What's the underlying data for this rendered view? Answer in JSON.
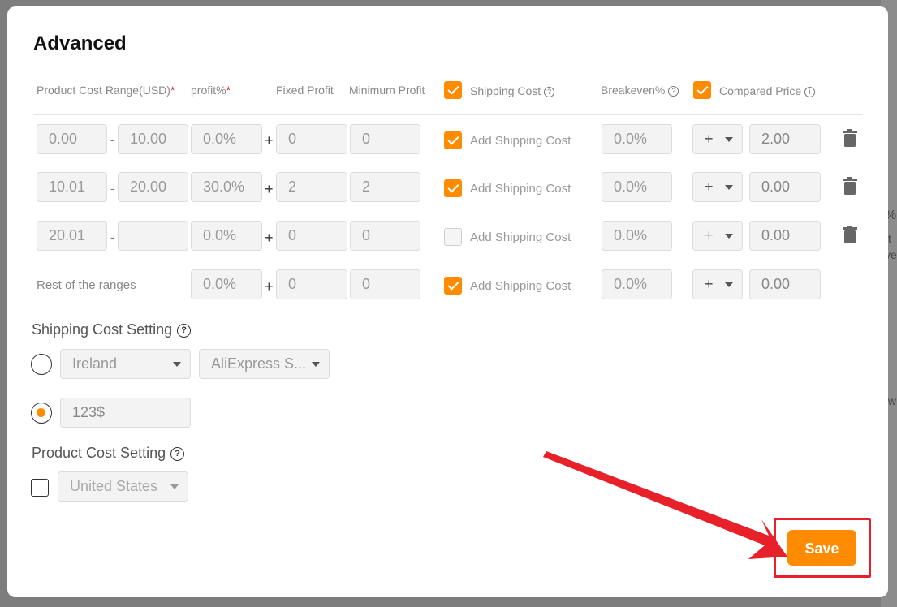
{
  "background": {
    "snippets": [
      "%",
      "t",
      "ve",
      "w"
    ]
  },
  "modal": {
    "title": "Advanced",
    "headers": {
      "product_cost_range": "Product Cost Range(USD)",
      "profit": "profit%",
      "required_mark": "*",
      "fixed_profit": "Fixed Profit",
      "minimum_profit": "Minimum Profit",
      "shipping_cost": "Shipping Cost",
      "breakeven": "Breakeven%",
      "compared_price": "Compared Price",
      "shipping_cost_checked": true,
      "compared_price_checked": true,
      "help_glyph": "?",
      "info_glyph": "i"
    },
    "rows": [
      {
        "min": "0.00",
        "max": "10.00",
        "profit": "0.0%",
        "fixed": "0",
        "minimum": "0",
        "add_shipping_checked": true,
        "add_shipping_label": "Add Shipping Cost",
        "breakeven": "0.0%",
        "operator": "+",
        "compared": "2.00"
      },
      {
        "min": "10.01",
        "max": "20.00",
        "profit": "30.0%",
        "fixed": "2",
        "minimum": "2",
        "add_shipping_checked": true,
        "add_shipping_label": "Add Shipping Cost",
        "breakeven": "0.0%",
        "operator": "+",
        "compared": "0.00"
      },
      {
        "min": "20.01",
        "max": "",
        "profit": "0.0%",
        "fixed": "0",
        "minimum": "0",
        "add_shipping_checked": false,
        "add_shipping_label": "Add Shipping Cost",
        "breakeven": "0.0%",
        "operator": "+",
        "compared": "0.00"
      }
    ],
    "rest_row": {
      "label": "Rest of the ranges",
      "profit": "0.0%",
      "fixed": "0",
      "minimum": "0",
      "add_shipping_checked": true,
      "add_shipping_label": "Add Shipping Cost",
      "breakeven": "0.0%",
      "operator": "+",
      "compared": "0.00"
    },
    "dash": "-",
    "plus": "+",
    "shipping_cost_setting": {
      "title": "Shipping Cost Setting",
      "country": "Ireland",
      "method": "AliExpress S...",
      "custom_value": "123$",
      "selected_option": "custom"
    },
    "product_cost_setting": {
      "title": "Product Cost Setting",
      "country": "United States",
      "checked": false
    },
    "save_label": "Save"
  },
  "colors": {
    "accent": "#ff8c00",
    "highlight": "#e8202a"
  }
}
